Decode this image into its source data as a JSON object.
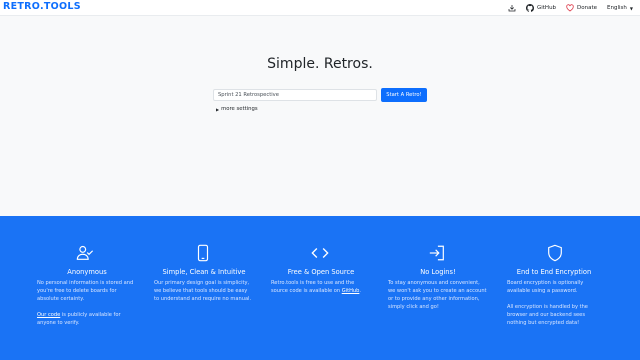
{
  "header": {
    "brand": "RETRO.TOOLS",
    "github_label": "GitHub",
    "donate_label": "Donate",
    "language_label": "English"
  },
  "main": {
    "title": "Simple. Retros.",
    "input_value": "Sprint 21 Retrospective",
    "start_button": "Start A Retro!",
    "more_settings": "more settings"
  },
  "features": [
    {
      "icon": "person-check-icon",
      "title": "Anonymous",
      "p1": "No personal information is stored and you're free to delete boards for absolute certainty.",
      "p2_link": "Our code",
      "p2_rest": " is publicly available for anyone to verify."
    },
    {
      "icon": "phone-icon",
      "title": "Simple, Clean & Intuitive",
      "p1": "Our primary design goal is simplicity, we believe that tools should be easy to understand and require no manual."
    },
    {
      "icon": "code-icon",
      "title": "Free & Open Source",
      "p1_pre": "Retro.tools is free to use and the source code is available on ",
      "p1_link": "GitHub",
      "p1_post": "."
    },
    {
      "icon": "sign-in-icon",
      "title": "No Logins!",
      "p1": "To stay anonymous and convenient, we won't ask you to create an account or to provide any other information, simply click and go!"
    },
    {
      "icon": "shield-icon",
      "title": "End to End Encryption",
      "p1": "Board encryption is optionally available using a password.",
      "p2": "All encryption is handled by the browser and our backend sees nothing but encrypted data!"
    }
  ],
  "colors": {
    "brand": "#0d6efd",
    "footer_bg": "#1a73f5",
    "heart": "#dc3545"
  }
}
